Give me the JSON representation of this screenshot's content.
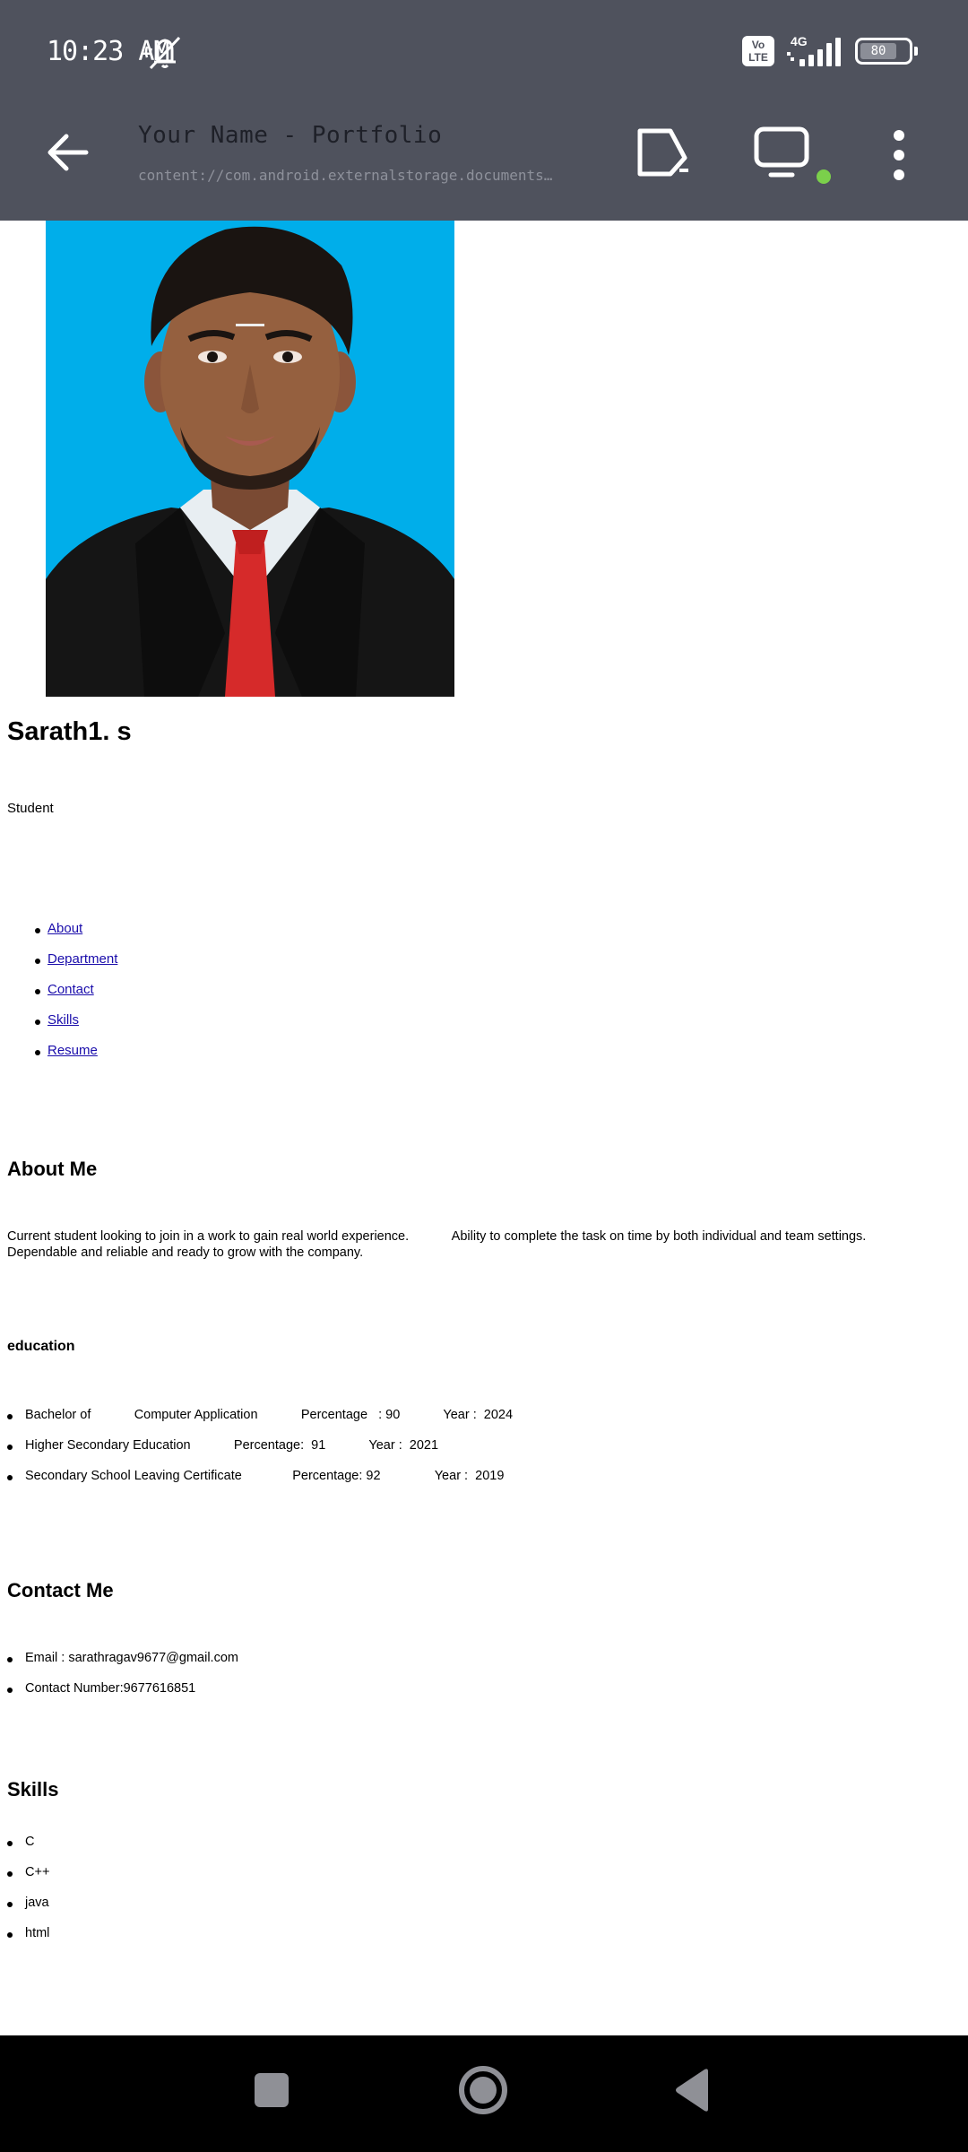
{
  "status_bar": {
    "time": "10:23 AM",
    "volte": "Vo LTE",
    "network": "4G",
    "battery": "80",
    "icons": [
      "mute-notifications-icon",
      "signal-icon",
      "battery-icon"
    ]
  },
  "toolbar": {
    "title": "Your Name - Portfolio",
    "url": "content://com.android.externalstorage.documents/tree/primary%3...",
    "icons": [
      "back-arrow-icon",
      "cast-icon",
      "screen-icon",
      "more-vertical-icon"
    ],
    "status_dot_color": "#7bd04b"
  },
  "profile": {
    "name": "Sarath1. s",
    "role": "Student",
    "photo_background": "#00aeea"
  },
  "nav": {
    "links": [
      "About",
      "Department",
      "Contact",
      "Skills",
      "Resume"
    ]
  },
  "about": {
    "heading": "About Me",
    "text": "Current student looking to join in a work to gain real world experience.            Ability to complete the task on time by both individual and team settings. Dependable and reliable and ready to grow with the company."
  },
  "education": {
    "heading": "education",
    "items": [
      "Bachelor of            Computer Application            Percentage   : 90            Year :  2024",
      "Higher Secondary Education            Percentage:  91            Year :  2021",
      "Secondary School Leaving Certificate              Percentage: 92               Year :  2019"
    ]
  },
  "contact": {
    "heading": "Contact Me",
    "items": [
      "Email : sarathragav9677@gmail.com",
      "Contact Number:9677616851"
    ]
  },
  "skills": {
    "heading": "Skills",
    "items": [
      "C",
      "C++",
      "java",
      "html"
    ]
  },
  "nav_bar": {
    "icons": [
      "recents-square-icon",
      "home-circle-icon",
      "back-triangle-icon"
    ]
  }
}
